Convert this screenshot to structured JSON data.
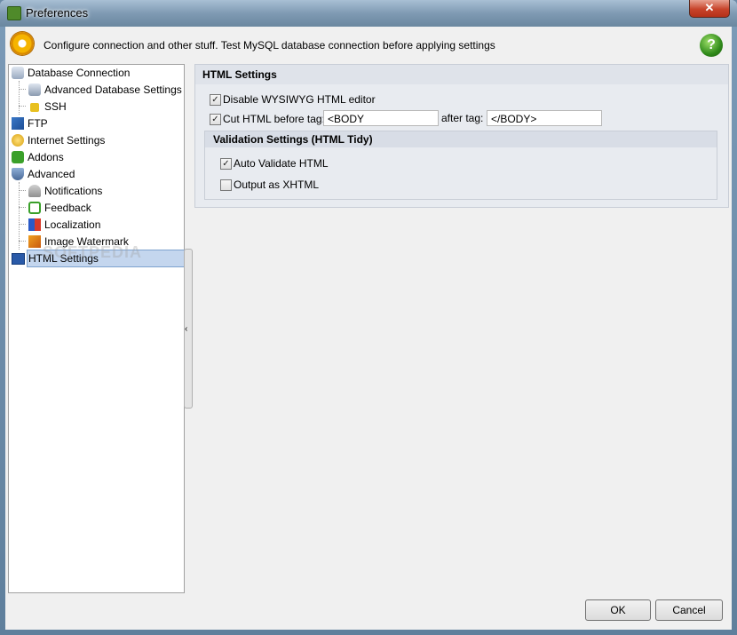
{
  "window": {
    "title": "Preferences",
    "close_label": "✕"
  },
  "header": {
    "text": "Configure connection and other stuff. Test MySQL database connection before applying settings",
    "help_label": "?"
  },
  "tree": {
    "items": [
      {
        "label": "Database Connection",
        "icon": "database-icon"
      },
      {
        "label": "Advanced Database Settings",
        "icon": "database-settings-icon"
      },
      {
        "label": "SSH",
        "icon": "lock-icon"
      },
      {
        "label": "FTP",
        "icon": "network-icon"
      },
      {
        "label": "Internet Settings",
        "icon": "globe-icon"
      },
      {
        "label": "Addons",
        "icon": "puzzle-icon"
      },
      {
        "label": "Advanced",
        "icon": "shield-icon"
      },
      {
        "label": "Notifications",
        "icon": "bell-icon"
      },
      {
        "label": "Feedback",
        "icon": "feedback-icon"
      },
      {
        "label": "Localization",
        "icon": "flags-icon"
      },
      {
        "label": "Image Watermark",
        "icon": "image-icon"
      },
      {
        "label": "HTML Settings",
        "icon": "html-icon",
        "selected": true
      }
    ]
  },
  "watermark": "SOFTPEDIA",
  "html_settings": {
    "title": "HTML Settings",
    "disable_wysiwyg": {
      "label": "Disable WYSIWYG HTML editor",
      "checked": true
    },
    "cut_html": {
      "label": "Cut HTML before tag:",
      "checked": true,
      "before_value": "<BODY",
      "after_label": "after tag:",
      "after_value": "</BODY>"
    },
    "validation": {
      "title": "Validation Settings (HTML Tidy)",
      "auto_validate": {
        "label": "Auto Validate HTML",
        "checked": true
      },
      "output_xhtml": {
        "label": "Output as XHTML",
        "checked": false
      }
    }
  },
  "buttons": {
    "ok": "OK",
    "cancel": "Cancel"
  },
  "check_mark": "✓"
}
